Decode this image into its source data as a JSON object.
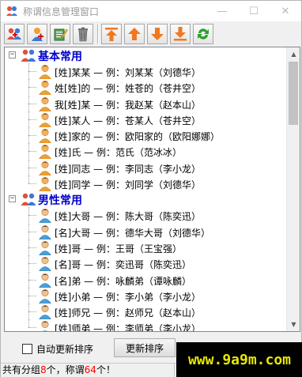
{
  "window": {
    "title": "称谓信息管理窗口",
    "minimize_glyph": "—",
    "maximize_glyph": "☐",
    "close_glyph": "✕"
  },
  "toolbar": {
    "buttons": [
      {
        "name": "add-group-icon"
      },
      {
        "name": "add-item-icon"
      },
      {
        "name": "edit-icon"
      },
      {
        "name": "delete-icon"
      },
      {
        "name": "move-top-icon"
      },
      {
        "name": "move-up-icon"
      },
      {
        "name": "move-down-icon"
      },
      {
        "name": "move-bottom-icon"
      },
      {
        "name": "refresh-icon"
      }
    ],
    "colors": {
      "arrow": "#f07820",
      "refresh": "#2aa02a",
      "group": "#e0503c"
    }
  },
  "tree": {
    "groups": [
      {
        "label": "基本常用",
        "expander": "−",
        "items": [
          "[姓]某某 — 例：刘某某（刘德华）",
          "姓[姓]的 — 例：姓苍的（苍井空）",
          "我[姓]某 — 例：我赵某（赵本山）",
          "[姓]某人 — 例：苍某人（苍井空）",
          "[姓]家的 — 例：欧阳家的（欧阳娜娜）",
          "[姓]氏 — 例：范氏（范冰冰）",
          "[姓]同志 — 例：李同志（李小龙）",
          "[姓]同学 — 例：刘同学（刘德华）"
        ]
      },
      {
        "label": "男性常用",
        "expander": "−",
        "items": [
          "[姓]大哥 — 例：陈大哥（陈奕迅）",
          "[名]大哥 — 例：德华大哥（刘德华）",
          "[姓]哥 — 例：王哥（王宝强）",
          "[名]哥 — 例：奕迅哥（陈奕迅）",
          "[名]弟 — 例：咏麟弟（谭咏麟）",
          "[姓]小弟 — 例：李小弟（李小龙）",
          "[姓]师兄 — 例：赵师兄（赵本山）",
          "[姓]师弟 — 例：李师弟（李小龙）"
        ]
      }
    ],
    "group_label_color": "#0000cc"
  },
  "bottom": {
    "auto_update_label": "自动更新排序",
    "auto_update_checked": false,
    "update_button_label": "更新排序"
  },
  "status": {
    "prefix": "共有分组",
    "group_count": "8",
    "middle": "个，称谓",
    "item_count": "64",
    "suffix": "个！"
  },
  "watermark": {
    "text": "www.9a9m.com"
  }
}
